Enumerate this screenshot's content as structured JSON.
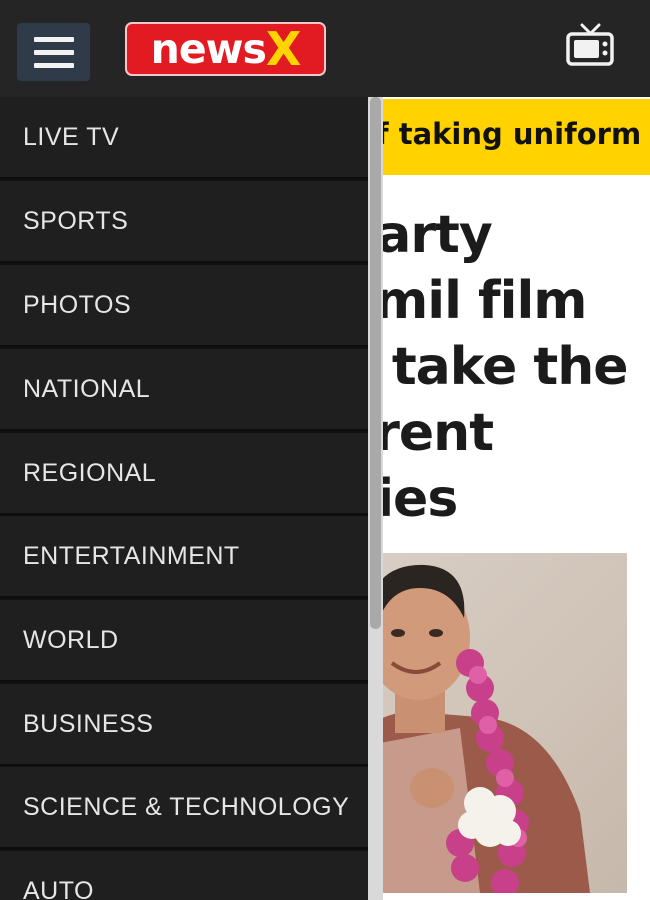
{
  "header": {
    "logo_main": "news",
    "logo_accent": "X",
    "icons": [
      "hamburger-menu-icon",
      "tv-icon"
    ]
  },
  "article": {
    "ticker": "f taking uniform m",
    "headline_lines": [
      "party",
      "amil film",
      "o take the",
      "erent",
      "gies"
    ]
  },
  "drawer": {
    "items": [
      {
        "label": "LIVE TV"
      },
      {
        "label": "SPORTS"
      },
      {
        "label": "PHOTOS"
      },
      {
        "label": "NATIONAL"
      },
      {
        "label": "REGIONAL"
      },
      {
        "label": "ENTERTAINMENT"
      },
      {
        "label": "WORLD"
      },
      {
        "label": "BUSINESS"
      },
      {
        "label": "SCIENCE & TECHNOLOGY"
      },
      {
        "label": "AUTO"
      }
    ]
  },
  "colors": {
    "header_bg": "#252525",
    "logo_red": "#e21b22",
    "logo_yellow": "#ffd400",
    "ticker_yellow": "#ffd200",
    "drawer_bg": "#1f1f1f"
  }
}
